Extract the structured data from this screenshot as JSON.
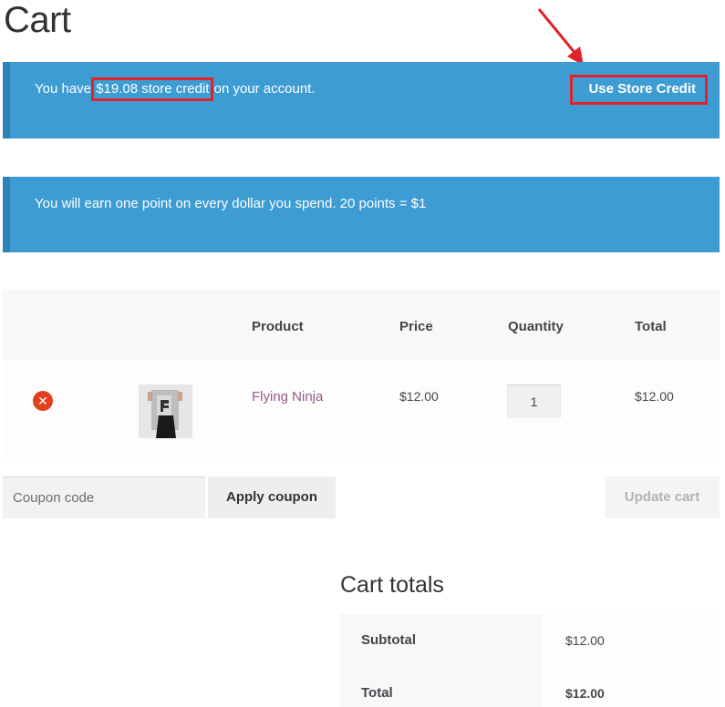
{
  "page": {
    "title": "Cart"
  },
  "notices": {
    "store_credit": {
      "prefix": "You have ",
      "amount": "$19.08 store credit",
      "suffix": " on your account.",
      "button_label": "Use Store Credit"
    },
    "points": {
      "text": "You will earn one point on every dollar you spend. 20 points = $1"
    }
  },
  "cart": {
    "headers": {
      "product": "Product",
      "price": "Price",
      "quantity": "Quantity",
      "total": "Total"
    },
    "items": [
      {
        "remove_icon": "remove-icon",
        "name": "Flying Ninja",
        "price": "$12.00",
        "quantity": "1",
        "total": "$12.00"
      }
    ]
  },
  "actions": {
    "coupon_placeholder": "Coupon code",
    "apply_coupon_label": "Apply coupon",
    "update_cart_label": "Update cart"
  },
  "totals": {
    "title": "Cart totals",
    "subtotal_label": "Subtotal",
    "subtotal_value": "$12.00",
    "total_label": "Total",
    "total_value": "$12.00"
  },
  "colors": {
    "notice_bg": "#3d9cd2",
    "highlight": "#e0232b",
    "product_link": "#96588a",
    "remove": "#e2401c"
  }
}
